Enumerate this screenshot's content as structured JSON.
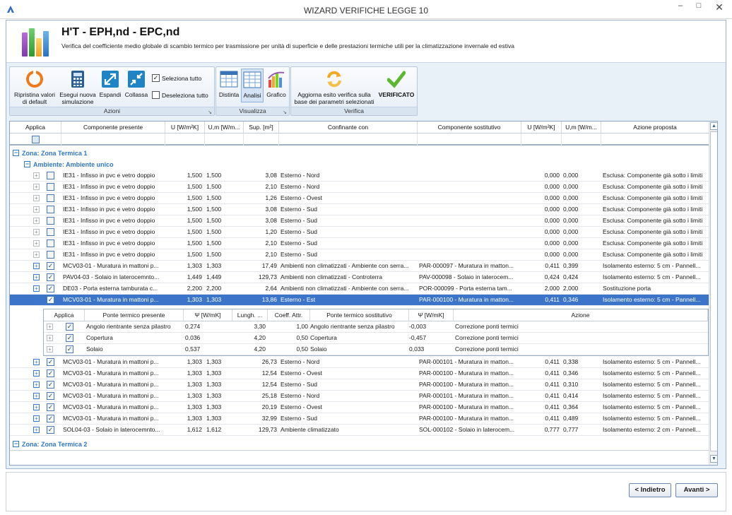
{
  "window": {
    "title": "WIZARD VERIFICHE LEGGE 10",
    "minimize": "–",
    "maximize": "□",
    "close": "✕"
  },
  "header": {
    "title": "H'T - EPH,nd - EPC,nd",
    "subtitle": "Verifica del coefficiente medio globale di scambio termico per trasmissione per unità di superficie e delle prestazioni termiche utili per la climatizzazione invernale ed estiva"
  },
  "ribbon": {
    "azioni": {
      "caption": "Azioni",
      "ripristina": "Ripristina valori di default",
      "esegui": "Esegui nuova simulazione",
      "espandi": "Espandi",
      "collassa": "Collassa",
      "seleziona": "Seleziona tutto",
      "deseleziona": "Deseleziona tutto"
    },
    "visualizza": {
      "caption": "Visualizza",
      "distinta": "Distinta",
      "analisi": "Analisi",
      "grafico": "Grafico"
    },
    "verifica": {
      "caption": "Verifica",
      "aggiorna": "Aggiorna esito verifica sulla base dei parametri selezionati",
      "verificato": "VERIFICATO"
    }
  },
  "grid": {
    "columns": [
      "Applica",
      "Componente presente",
      "U [W/m²K]",
      "U,m [W/m...",
      "Sup. [m²]",
      "Confinante con",
      "Componente sostitutivo",
      "U [W/m²K]",
      "U,m [W/m...",
      "Azione proposta"
    ],
    "zone1": "Zona: Zona Termica 1",
    "ambiente": "Ambiente: Ambiente unico",
    "zone2": "Zona: Zona Termica 2",
    "rows": [
      {
        "checked": false,
        "comp": "IE31 - Infisso in pvc e vetro doppio",
        "u": "1,500",
        "um": "1,500",
        "sup": "3,08",
        "conf": "Esterno - Nord",
        "sost": "",
        "u2": "0,000",
        "um2": "0,000",
        "azione": "Esclusa: Componente già sotto i limiti"
      },
      {
        "checked": false,
        "comp": "IE31 - Infisso in pvc e vetro doppio",
        "u": "1,500",
        "um": "1,500",
        "sup": "2,10",
        "conf": "Esterno - Nord",
        "sost": "",
        "u2": "0,000",
        "um2": "0,000",
        "azione": "Esclusa: Componente già sotto i limiti"
      },
      {
        "checked": false,
        "comp": "IE31 - Infisso in pvc e vetro doppio",
        "u": "1,500",
        "um": "1,500",
        "sup": "1,26",
        "conf": "Esterno - Ovest",
        "sost": "",
        "u2": "0,000",
        "um2": "0,000",
        "azione": "Esclusa: Componente già sotto i limiti"
      },
      {
        "checked": false,
        "comp": "IE31 - Infisso in pvc e vetro doppio",
        "u": "1,500",
        "um": "1,500",
        "sup": "3,08",
        "conf": "Esterno - Sud",
        "sost": "",
        "u2": "0,000",
        "um2": "0,000",
        "azione": "Esclusa: Componente già sotto i limiti"
      },
      {
        "checked": false,
        "comp": "IE31 - Infisso in pvc e vetro doppio",
        "u": "1,500",
        "um": "1,500",
        "sup": "3,08",
        "conf": "Esterno - Sud",
        "sost": "",
        "u2": "0,000",
        "um2": "0,000",
        "azione": "Esclusa: Componente già sotto i limiti"
      },
      {
        "checked": false,
        "comp": "IE31 - Infisso in pvc e vetro doppio",
        "u": "1,500",
        "um": "1,500",
        "sup": "1,20",
        "conf": "Esterno - Sud",
        "sost": "",
        "u2": "0,000",
        "um2": "0,000",
        "azione": "Esclusa: Componente già sotto i limiti"
      },
      {
        "checked": false,
        "comp": "IE31 - Infisso in pvc e vetro doppio",
        "u": "1,500",
        "um": "1,500",
        "sup": "2,10",
        "conf": "Esterno - Sud",
        "sost": "",
        "u2": "0,000",
        "um2": "0,000",
        "azione": "Esclusa: Componente già sotto i limiti"
      },
      {
        "checked": false,
        "comp": "IE31 - Infisso in pvc e vetro doppio",
        "u": "1,500",
        "um": "1,500",
        "sup": "2,10",
        "conf": "Esterno - Sud",
        "sost": "",
        "u2": "0,000",
        "um2": "0,000",
        "azione": "Esclusa: Componente già sotto i limiti"
      },
      {
        "checked": true,
        "comp": "MCV03-01 - Muratura in mattoni p...",
        "u": "1,303",
        "um": "1,303",
        "sup": "17,49",
        "conf": "Ambienti non climatizzati - Ambiente con serra...",
        "sost": "PAR-000097 - Muratura in matton...",
        "u2": "0,411",
        "um2": "0,399",
        "azione": "Isolamento esterno: 5 cm - Pannell..."
      },
      {
        "checked": true,
        "comp": "PAV04-03 - Solaio in laterocemnto...",
        "u": "1,449",
        "um": "1,449",
        "sup": "129,73",
        "conf": "Ambienti non climatizzati - Controterra",
        "sost": "PAV-000098 - Solaio in laterocem...",
        "u2": "0,424",
        "um2": "0,424",
        "azione": "Isolamento esterno: 5 cm - Pannell..."
      },
      {
        "checked": true,
        "comp": "DE03 - Porta esterna tamburata c...",
        "u": "2,200",
        "um": "2,200",
        "sup": "2,64",
        "conf": "Ambienti non climatizzati - Ambiente con serra...",
        "sost": "POR-000099 - Porta esterna tam...",
        "u2": "2,000",
        "um2": "2,000",
        "azione": "Sostituzione porta"
      },
      {
        "checked": true,
        "comp": "MCV03-01 - Muratura in mattoni p...",
        "u": "1,303",
        "um": "1,303",
        "sup": "13,86",
        "conf": "Esterno - Est",
        "sost": "PAR-000100 - Muratura in matton...",
        "u2": "0,411",
        "um2": "0,346",
        "azione": "Isolamento esterno: 5 cm - Pannell..."
      }
    ],
    "rows2": [
      {
        "comp": "MCV03-01 - Muratura in mattoni p...",
        "u": "1,303",
        "um": "1,303",
        "sup": "26,73",
        "conf": "Esterno - Nord",
        "sost": "PAR-000101 - Muratura in matton...",
        "u2": "0,411",
        "um2": "0,338",
        "azione": "Isolamento esterno: 5 cm - Pannell..."
      },
      {
        "comp": "MCV03-01 - Muratura in mattoni p...",
        "u": "1,303",
        "um": "1,303",
        "sup": "12,54",
        "conf": "Esterno - Ovest",
        "sost": "PAR-000100 - Muratura in matton...",
        "u2": "0,411",
        "um2": "0,346",
        "azione": "Isolamento esterno: 5 cm - Pannell..."
      },
      {
        "comp": "MCV03-01 - Muratura in mattoni p...",
        "u": "1,303",
        "um": "1,303",
        "sup": "12,54",
        "conf": "Esterno - Sud",
        "sost": "PAR-000100 - Muratura in matton...",
        "u2": "0,411",
        "um2": "0,310",
        "azione": "Isolamento esterno: 5 cm - Pannell..."
      },
      {
        "comp": "MCV03-01 - Muratura in mattoni p...",
        "u": "1,303",
        "um": "1,303",
        "sup": "25,18",
        "conf": "Esterno - Nord",
        "sost": "PAR-000101 - Muratura in matton...",
        "u2": "0,411",
        "um2": "0,414",
        "azione": "Isolamento esterno: 5 cm - Pannell..."
      },
      {
        "comp": "MCV03-01 - Muratura in mattoni p...",
        "u": "1,303",
        "um": "1,303",
        "sup": "20,19",
        "conf": "Esterno - Ovest",
        "sost": "PAR-000100 - Muratura in matton...",
        "u2": "0,411",
        "um2": "0,364",
        "azione": "Isolamento esterno: 5 cm - Pannell..."
      },
      {
        "comp": "MCV03-01 - Muratura in mattoni p...",
        "u": "1,303",
        "um": "1,303",
        "sup": "32,99",
        "conf": "Esterno - Sud",
        "sost": "PAR-000100 - Muratura in matton...",
        "u2": "0,411",
        "um2": "0,489",
        "azione": "Isolamento esterno: 5 cm - Pannell..."
      },
      {
        "comp": "SOL04-03 - Solaio in laterocemnto...",
        "u": "1,612",
        "um": "1,612",
        "sup": "129,73",
        "conf": "Ambiente climatizzato",
        "sost": "SOL-000102 - Solaio in laterocem...",
        "u2": "0,777",
        "um2": "0,777",
        "azione": "Isolamento esterno: 2 cm - Pannell..."
      }
    ]
  },
  "subgrid": {
    "columns": [
      "Applica",
      "Ponte termico presente",
      "Ψ [W/mK]",
      "Lungh. ...",
      "Coeff. Attr.",
      "Ponte termico sostitutivo",
      "Ψ [W/mK]",
      "Azione"
    ],
    "rows": [
      {
        "presente": "Angolo rientrante senza pilastro",
        "psi": "0,274",
        "lungh": "3,30",
        "coeff": "1,00",
        "sost": "Angolo rientrante senza pilastro",
        "psi2": "-0,003",
        "azione": "Correzione ponti termici"
      },
      {
        "presente": "Copertura",
        "psi": "0,036",
        "lungh": "4,20",
        "coeff": "0,50",
        "sost": "Copertura",
        "psi2": "-0,457",
        "azione": "Correzione ponti termici"
      },
      {
        "presente": "Solaio",
        "psi": "0,537",
        "lungh": "4,20",
        "coeff": "0,50",
        "sost": "Solaio",
        "psi2": "0,033",
        "azione": "Correzione ponti termici"
      }
    ]
  },
  "footer": {
    "back": "< Indietro",
    "next": "Avanti >"
  }
}
